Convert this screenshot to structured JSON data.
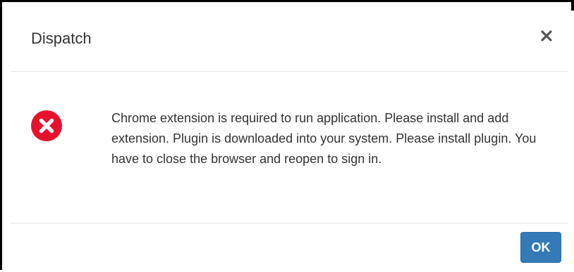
{
  "dialog": {
    "title": "Dispatch",
    "close_icon": "close-icon",
    "message": "Chrome extension is required to run application. Please install and add extension. Plugin is downloaded into your system. Please install plugin. You have to close the browser and reopen to sign in.",
    "status_icon": "error-circle-icon",
    "ok_label": "OK"
  },
  "colors": {
    "error": "#e8112d",
    "primary_button": "#337ab7",
    "divider": "#e5e5e5",
    "text": "#333333"
  }
}
